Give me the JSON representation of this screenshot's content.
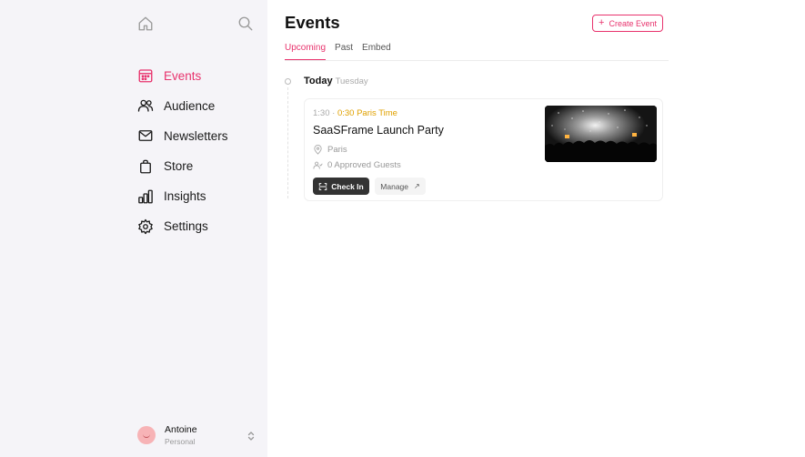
{
  "sidebar": {
    "top_icons": [
      "home-icon",
      "search-icon"
    ],
    "items": [
      {
        "label": "Events",
        "icon": "calendar-icon",
        "active": true
      },
      {
        "label": "Audience",
        "icon": "users-icon",
        "active": false
      },
      {
        "label": "Newsletters",
        "icon": "mail-icon",
        "active": false
      },
      {
        "label": "Store",
        "icon": "bag-icon",
        "active": false
      },
      {
        "label": "Insights",
        "icon": "bar-chart-icon",
        "active": false
      },
      {
        "label": "Settings",
        "icon": "gear-icon",
        "active": false
      }
    ],
    "user": {
      "name": "Antoine",
      "subtitle": "Personal"
    }
  },
  "main": {
    "title": "Events",
    "create_button": "Create Event",
    "tabs": [
      {
        "label": "Upcoming",
        "active": true
      },
      {
        "label": "Past",
        "active": false
      },
      {
        "label": "Embed",
        "active": false
      }
    ],
    "day": {
      "label": "Today",
      "weekday": "Tuesday"
    },
    "event": {
      "time_start": "1:30",
      "separator": "·",
      "time_local": "0:30 Paris Time",
      "title": "SaaSFrame Launch Party",
      "location": "Paris",
      "guests": "0 Approved Guests",
      "checkin_label": "Check In",
      "manage_label": "Manage"
    }
  },
  "colors": {
    "accent": "#e8336d",
    "time_highlight": "#e0a100",
    "sidebar_bg": "#f5f4f8"
  }
}
